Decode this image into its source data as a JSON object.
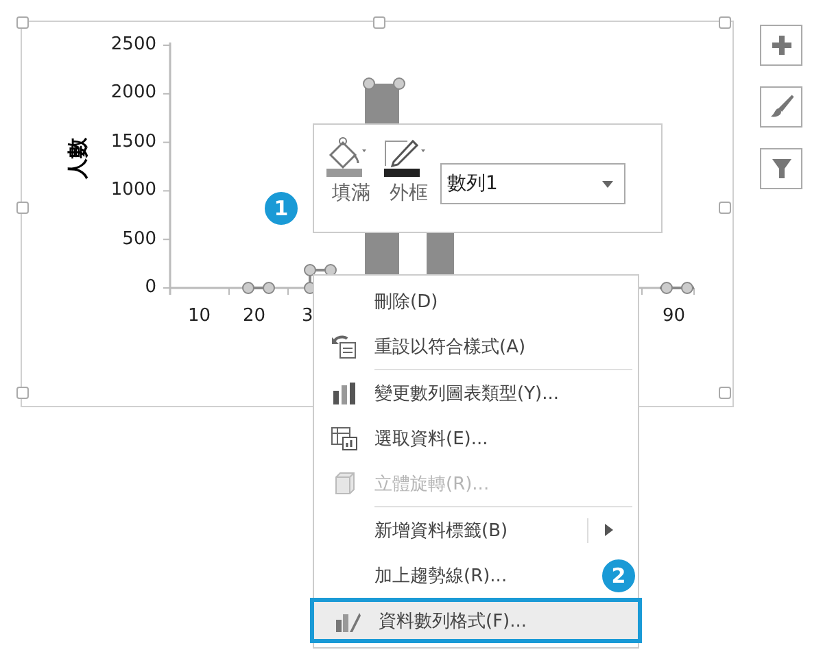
{
  "chart": {
    "ylabel": "人數",
    "yticks": [
      "2500",
      "2000",
      "1500",
      "1000",
      "500",
      "0"
    ],
    "xticks": [
      "10",
      "20",
      "3",
      "90"
    ]
  },
  "side_buttons": [
    {
      "kind": "plus"
    },
    {
      "kind": "brush"
    },
    {
      "kind": "filter"
    }
  ],
  "mini_toolbar": {
    "fill_label": "填滿",
    "outline_label": "外框",
    "series_select": "數列1"
  },
  "callouts": [
    "1",
    "2"
  ],
  "context_menu": [
    {
      "label": "刪除(D)",
      "icon": false,
      "disabled": false,
      "submenu": false,
      "separator_before": false,
      "selected": false
    },
    {
      "label": "重設以符合樣式(A)",
      "icon": true,
      "disabled": false,
      "submenu": false,
      "separator_before": false,
      "selected": false
    },
    {
      "label": "變更數列圖表類型(Y)...",
      "icon": true,
      "disabled": false,
      "submenu": false,
      "separator_before": true,
      "selected": false
    },
    {
      "label": "選取資料(E)...",
      "icon": true,
      "disabled": false,
      "submenu": false,
      "separator_before": false,
      "selected": false
    },
    {
      "label": "立體旋轉(R)...",
      "icon": true,
      "disabled": true,
      "submenu": false,
      "separator_before": false,
      "selected": false
    },
    {
      "label": "新增資料標籤(B)",
      "icon": false,
      "disabled": false,
      "submenu": true,
      "separator_before": true,
      "selected": false
    },
    {
      "label": "加上趨勢線(R)...",
      "icon": false,
      "disabled": false,
      "submenu": false,
      "separator_before": false,
      "selected": false
    },
    {
      "label": "資料數列格式(F)...",
      "icon": true,
      "disabled": false,
      "submenu": false,
      "separator_before": false,
      "selected": true
    }
  ]
}
